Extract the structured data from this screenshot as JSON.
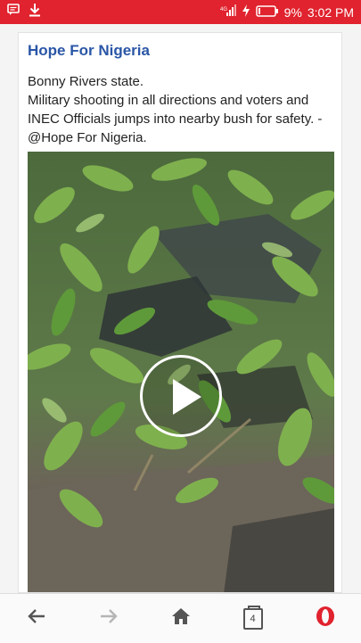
{
  "status_bar": {
    "battery": "9%",
    "time": "3:02 PM",
    "background": "#e0232e"
  },
  "post": {
    "title": "Hope For Nigeria",
    "line1": "Bonny Rivers state.",
    "line2": "Military shooting in all directions and voters and INEC Officials jumps into nearby bush for safety. -@Hope For Nigeria.",
    "title_color": "#2a56a6"
  },
  "video": {
    "play_icon": "play-icon"
  },
  "bottom_nav": {
    "back_icon": "back-arrow-icon",
    "forward_icon": "forward-arrow-icon",
    "home_icon": "home-icon",
    "tab_count": "4",
    "opera_icon": "opera-icon"
  }
}
